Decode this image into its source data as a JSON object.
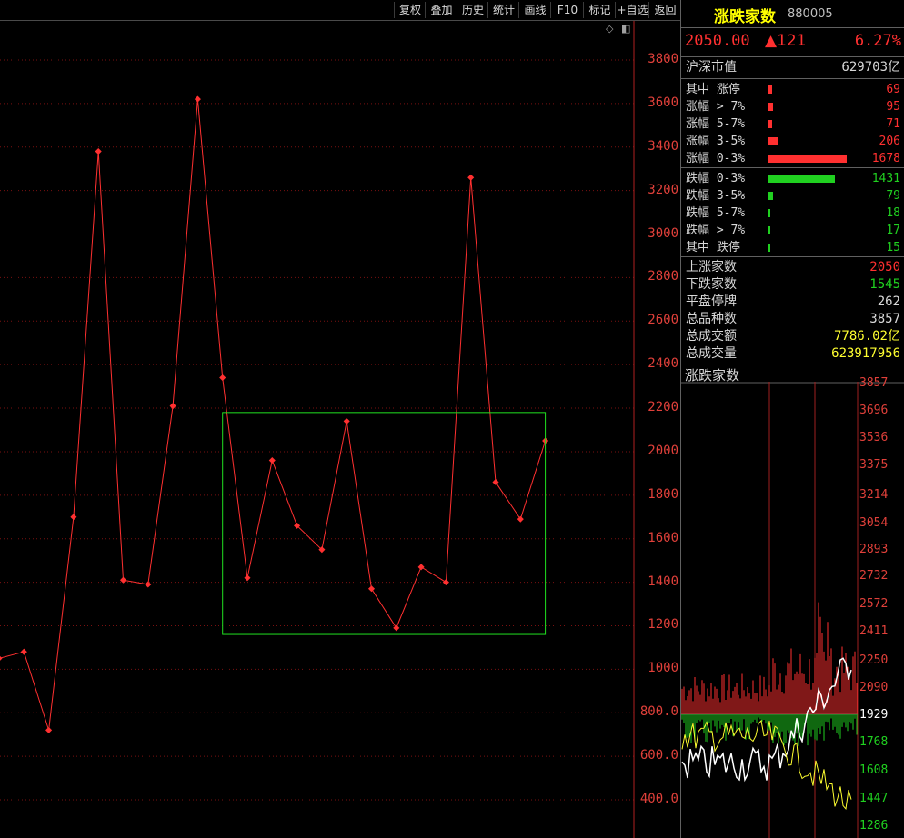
{
  "toolbar": {
    "buttons": [
      "复权",
      "叠加",
      "历史",
      "统计",
      "画线",
      "F10",
      "标记",
      "+自选",
      "返回"
    ]
  },
  "chart_data": [
    {
      "type": "line",
      "series": [
        {
          "values": [
            1050,
            1080,
            720,
            1700,
            3380,
            1410,
            1390,
            2210,
            3620,
            2340,
            1420,
            1960,
            1660,
            1550,
            2140,
            1370,
            1190,
            1470,
            1400,
            3260,
            1860,
            1690,
            2050
          ]
        }
      ],
      "ylim": [
        300,
        3900
      ],
      "yticks": [
        "3800",
        "3600",
        "3400",
        "3200",
        "3000",
        "2800",
        "2600",
        "2400",
        "2200",
        "2000",
        "1800",
        "1600",
        "1400",
        "1200",
        "1000",
        "800.0",
        "600.0",
        "400.0"
      ],
      "annotation_box": {
        "from_index": 9,
        "to_index": 22,
        "y_low": 1160,
        "y_high": 2180
      },
      "colors": {
        "line": "#ff3030",
        "box": "#20e020",
        "grid": "#7a1010"
      }
    },
    {
      "type": "bar",
      "title": "涨跌家数",
      "yticks_up": [
        "3857",
        "3696",
        "3536",
        "3375",
        "3214",
        "3054",
        "2893",
        "2732",
        "2572",
        "2411",
        "2250",
        "2090"
      ],
      "mid_tick": "1929",
      "yticks_down": [
        "1768",
        "1608",
        "1447",
        "1286"
      ],
      "ylim": [
        1286,
        3857
      ],
      "colors": {
        "up": "#ff3030",
        "down": "#20d020",
        "white_line": "#ffffff",
        "yellow_line": "#ffff30"
      }
    }
  ],
  "panel": {
    "title": "涨跌家数",
    "code": "880005",
    "price": "2050.00",
    "change": "▲121",
    "change_pct": "6.27%",
    "market_cap_label": "沪深市值",
    "market_cap_value": "629703亿",
    "up_rows": [
      {
        "label": "其中 涨停",
        "value": "69"
      },
      {
        "label": "涨幅 > 7%",
        "value": "95"
      },
      {
        "label": "涨幅 5-7%",
        "value": "71"
      },
      {
        "label": "涨幅 3-5%",
        "value": "206"
      },
      {
        "label": "涨幅 0-3%",
        "value": "1678"
      }
    ],
    "down_rows": [
      {
        "label": "跌幅 0-3%",
        "value": "1431"
      },
      {
        "label": "跌幅 3-5%",
        "value": "79"
      },
      {
        "label": "跌幅 5-7%",
        "value": "18"
      },
      {
        "label": "跌幅 > 7%",
        "value": "17"
      },
      {
        "label": "其中 跌停",
        "value": "15"
      }
    ],
    "stats": [
      {
        "label": "上涨家数",
        "value": "2050",
        "color": "#ff3030"
      },
      {
        "label": "下跌家数",
        "value": "1545",
        "color": "#20d020"
      },
      {
        "label": "平盘停牌",
        "value": "262",
        "color": "#d8d8d8"
      },
      {
        "label": "总品种数",
        "value": "3857",
        "color": "#d8d8d8"
      },
      {
        "label": "总成交额",
        "value": "7786.02亿",
        "color": "#ffff30"
      },
      {
        "label": "总成交量",
        "value": "623917956",
        "color": "#ffff30"
      }
    ],
    "mini_title": "涨跌家数"
  },
  "icons": {
    "diamond": "◇",
    "window": "◧"
  }
}
